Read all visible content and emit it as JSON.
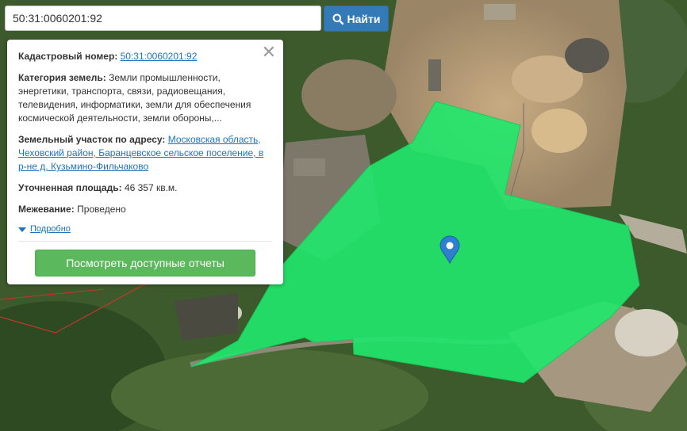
{
  "search": {
    "value": "50:31:0060201:92",
    "button_label": "Найти",
    "button_icon": "search-icon"
  },
  "parcel": {
    "fill_color": "#1fe86b",
    "marker_color": "#2f7fd1",
    "marker_icon": "map-pin-icon"
  },
  "info": {
    "close_icon": "close-icon",
    "cadastral_label": "Кадастровый номер:",
    "cadastral_value": "50:31:0060201:92",
    "category_label": "Категория земель:",
    "category_value": "Земли промышленности, энергетики, транспорта, связи, радиовещания, телевидения, информатики, земли для обеспечения космической деятельности, земли обороны,...",
    "address_label": "Земельный участок по адресу:",
    "address_value": "Московская область, Чеховский район, Баранцевское сельское поселение, в р-не д. Кузьмино-Фильчаково",
    "area_label": "Уточненная площадь:",
    "area_value": "46 357 кв.м.",
    "survey_label": "Межевание:",
    "survey_value": "Проведено",
    "more_label": "Подробно",
    "reports_button": "Посмотреть доступные отчеты"
  }
}
